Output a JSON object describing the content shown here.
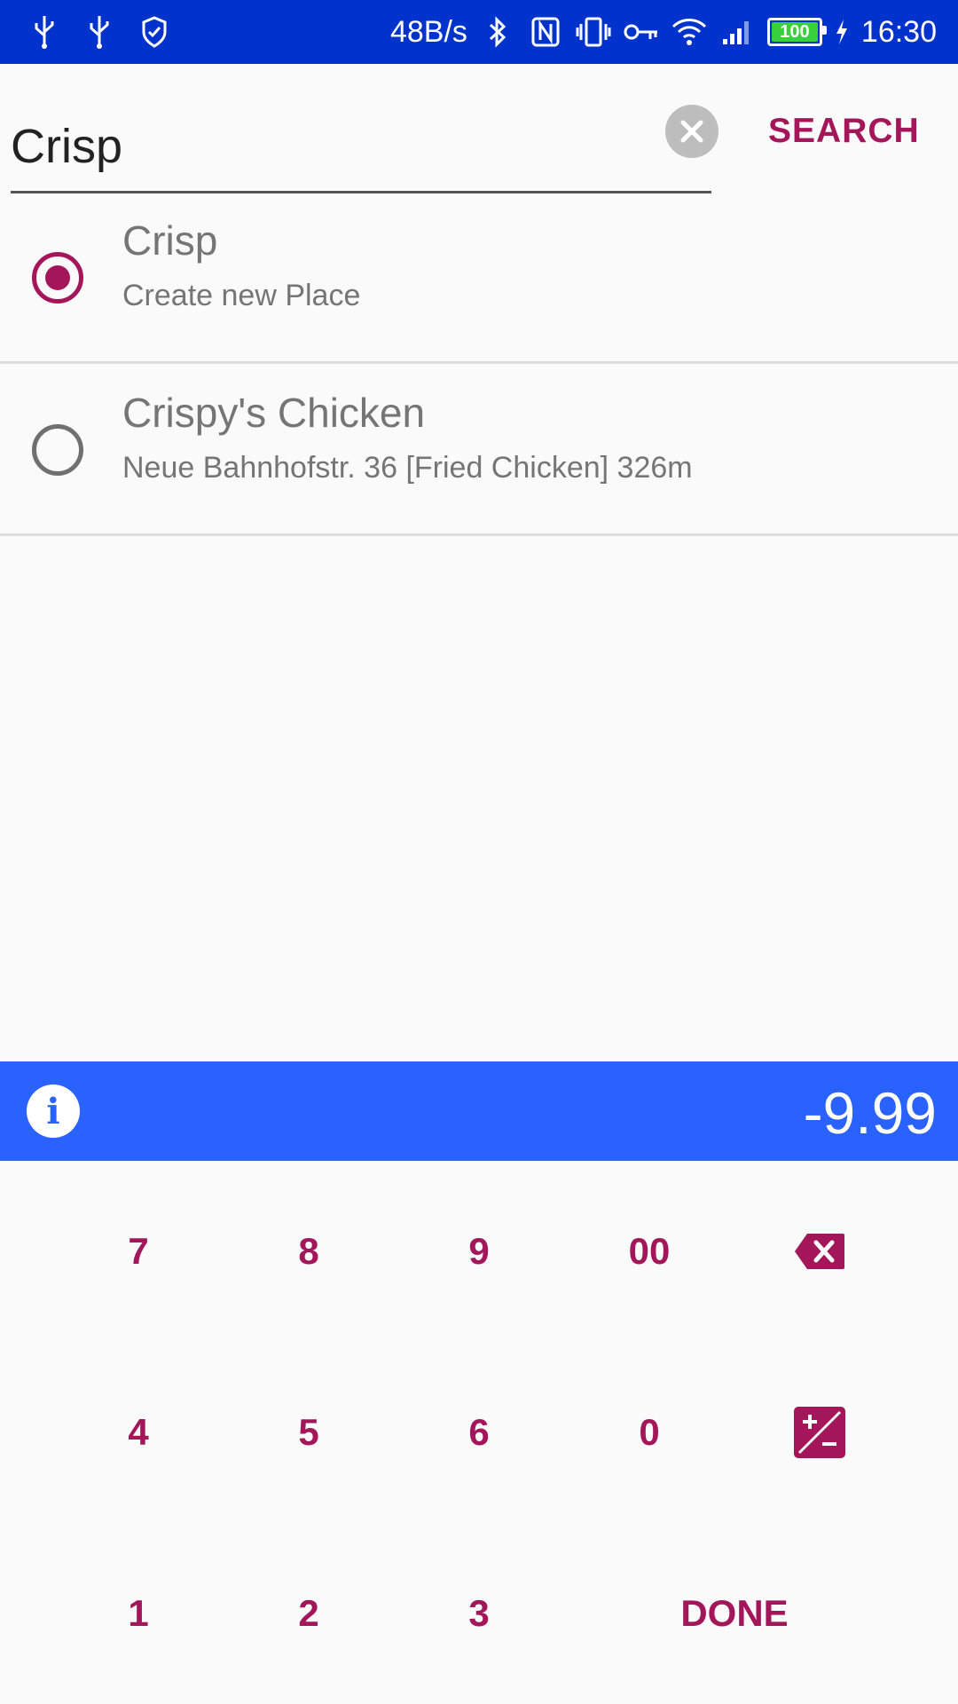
{
  "status_bar": {
    "left_icons": [
      "usb-icon",
      "usb-icon",
      "shield-icon"
    ],
    "net_speed": "48B/s",
    "right_icons": [
      "bluetooth-icon",
      "nfc-icon",
      "vibrate-icon",
      "vpn-key-icon",
      "wifi-icon",
      "signal-icon"
    ],
    "battery": "100",
    "time": "16:30"
  },
  "search": {
    "value": "Crisp",
    "placeholder": "",
    "button_label": "SEARCH"
  },
  "results": [
    {
      "title": "Crisp",
      "subtitle": "Create new Place",
      "selected": true
    },
    {
      "title": "Crispy's Chicken",
      "subtitle": "Neue Bahnhofstr. 36 [Fried Chicken] 326m",
      "selected": false
    }
  ],
  "amount_bar": {
    "icon": "info-icon",
    "amount": "-9.99"
  },
  "keypad": {
    "k7": "7",
    "k8": "8",
    "k9": "9",
    "k00": "00",
    "k4": "4",
    "k5": "5",
    "k6": "6",
    "k0": "0",
    "k1": "1",
    "k2": "2",
    "k3": "3",
    "done": "DONE",
    "backspace_icon": "backspace-icon",
    "plus_minus_icon": "plus-minus-icon"
  },
  "colors": {
    "accent": "#a3175a",
    "status_bar": "#0033cc",
    "amount_bar": "#2962ff"
  }
}
